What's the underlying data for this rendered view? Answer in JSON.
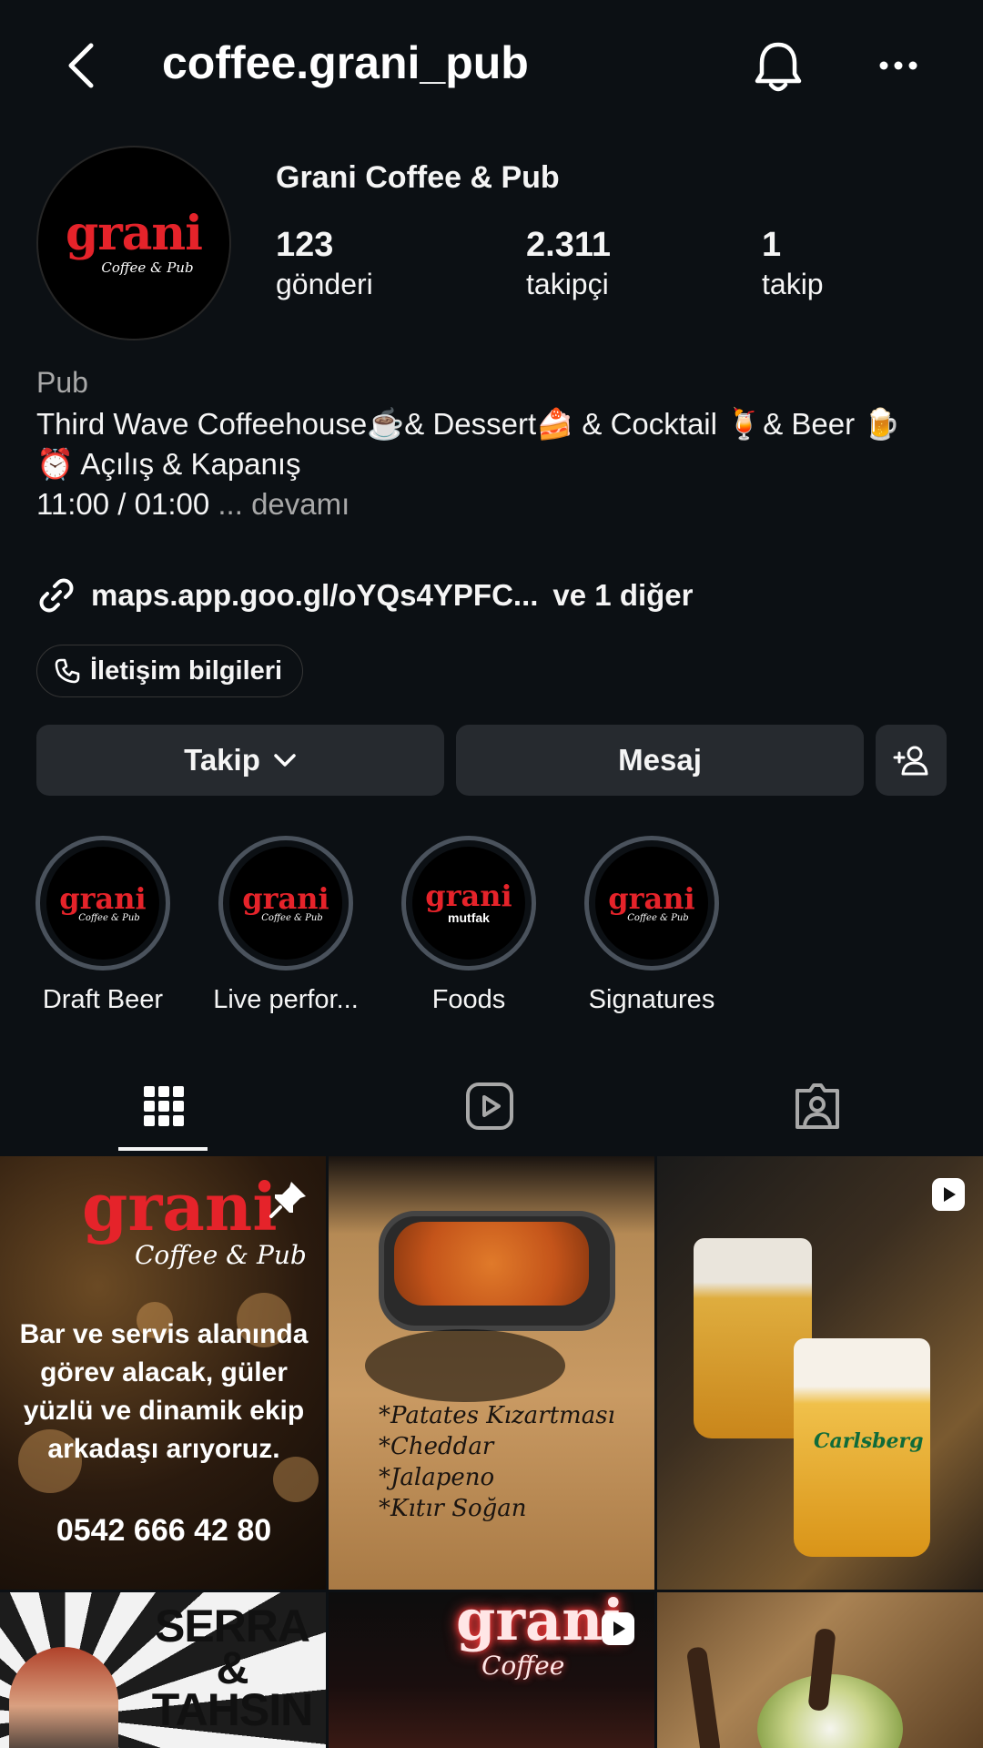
{
  "header": {
    "username": "coffee.grani_pub"
  },
  "profile": {
    "avatar_logo": "grani",
    "avatar_logo_sub": "Coffee & Pub",
    "display_name": "Grani Coffee & Pub",
    "stats": [
      {
        "value": "123",
        "label": "gönderi"
      },
      {
        "value": "2.311",
        "label": "takipçi"
      },
      {
        "value": "1",
        "label": "takip"
      }
    ],
    "category": "Pub",
    "bio_line1": "Third Wave Coffeehouse☕️& Dessert🍰 & Cocktail 🍹& Beer 🍺",
    "bio_line2": "⏰ Açılış & Kapanış",
    "bio_line3": "11:00 / 01:00",
    "bio_more": "... devamı",
    "link_text": "maps.app.goo.gl/oYQs4YPFC...",
    "link_extra": "ve 1 diğer",
    "contact_label": "İletişim bilgileri"
  },
  "actions": {
    "follow_label": "Takip",
    "message_label": "Mesaj"
  },
  "highlights": [
    {
      "label": "Draft Beer",
      "logo": "grani",
      "sub": "Coffee & Pub"
    },
    {
      "label": "Live perfor...",
      "logo": "grani",
      "sub": "Coffee & Pub"
    },
    {
      "label": "Foods",
      "logo": "grani",
      "sub": "mutfak"
    },
    {
      "label": "Signatures",
      "logo": "grani",
      "sub": "Coffee & Pub"
    }
  ],
  "posts": {
    "p1": {
      "logo": "grani",
      "logo_sub": "Coffee & Pub",
      "text": "Bar ve servis alanında görev alacak, güler yüzlü ve dinamik ekip arkadaşı arıyoruz.",
      "phone": "0542 666 42 80"
    },
    "p2": {
      "menu": [
        "*Patates Kızartması",
        "*Cheddar",
        "*Jalapeno",
        "*Kıtır Soğan"
      ]
    },
    "p3": {
      "brand": "Carlsberg"
    },
    "p4": {
      "line1": "SERRA",
      "line2": "&",
      "line3": "TAHSIN"
    },
    "p5": {
      "logo": "grani",
      "logo_sub": "Coffee"
    }
  },
  "colors": {
    "background": "#0c1014",
    "button": "#262a2f",
    "brand_red": "#e5232a",
    "secondary_text": "#a8a8a8"
  }
}
